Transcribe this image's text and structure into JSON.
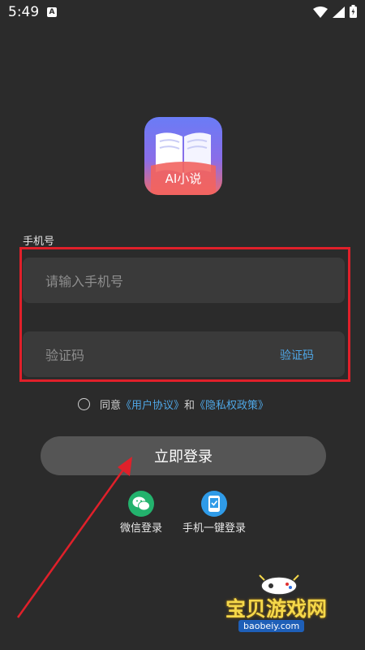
{
  "status_bar": {
    "time": "5:49",
    "notification_badge": "A"
  },
  "app": {
    "logo_text": "AI小说"
  },
  "form": {
    "phone_label": "手机号",
    "phone_placeholder": "请输入手机号",
    "phone_value": "",
    "code_placeholder": "验证码",
    "code_value": "",
    "get_code_label": "验证码"
  },
  "agreement": {
    "checked": false,
    "prefix": "同意",
    "user_agreement": "《用户协议》",
    "and": "和",
    "privacy_policy": "《隐私权政策》"
  },
  "login_button": "立即登录",
  "alt_login": [
    {
      "label": "微信登录",
      "icon": "wechat-icon",
      "color": "#23b26d"
    },
    {
      "label": "手机一键登录",
      "icon": "phone-icon",
      "color": "#2f9be8"
    }
  ],
  "watermark": {
    "title": "宝贝游戏网",
    "url": "baobeiy.com"
  },
  "colors": {
    "background": "#2b2b2b",
    "field": "#3a3a3a",
    "link": "#4fa7e6",
    "highlight": "#e0202a",
    "button": "#555555"
  }
}
